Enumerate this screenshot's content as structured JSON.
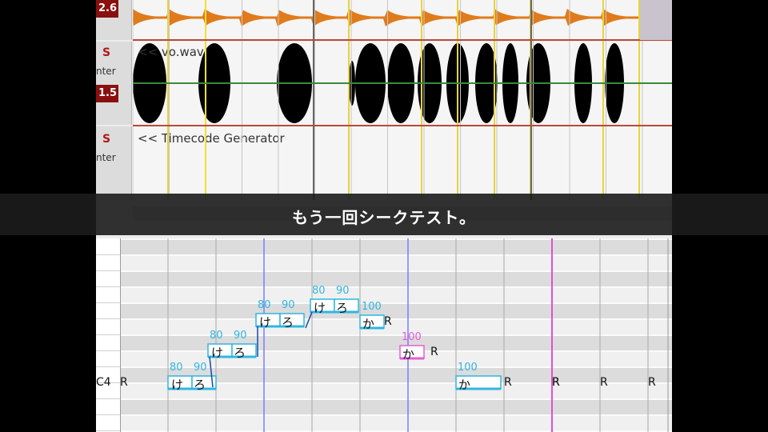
{
  "caption": "もう一回シークテスト。",
  "tracks": [
    {
      "solo_label": "S",
      "pan_label": "nter",
      "volume": "2.6",
      "lane_label": ""
    },
    {
      "solo_label": "S",
      "pan_label": "nter",
      "volume": "1.5",
      "lane_label": "<< vo.wav"
    },
    {
      "solo_label": "S",
      "pan_label": "nter",
      "volume": "",
      "lane_label": "<< Timecode Generator"
    }
  ],
  "colors": {
    "wave_orange": "#e07b1c",
    "wave_purple": "#7b3a9a",
    "note_blue": "#2fb6e0",
    "note_pink": "#e85ad9",
    "marker_pink": "#e34fd6"
  },
  "piano_roll": {
    "key_label": "C4",
    "notes": [
      {
        "group": 1,
        "lyrics": [
          "け",
          "ろ"
        ],
        "velocities": [
          "80",
          "90"
        ]
      },
      {
        "group": 2,
        "lyrics": [
          "け",
          "ろ"
        ],
        "velocities": [
          "80",
          "90"
        ]
      },
      {
        "group": 3,
        "lyrics": [
          "け",
          "ろ"
        ],
        "velocities": [
          "80",
          "90"
        ]
      },
      {
        "group": 4,
        "lyrics": [
          "け",
          "ろ"
        ],
        "velocities": [
          "80",
          "90"
        ]
      },
      {
        "group": 5,
        "lyrics": [
          "か"
        ],
        "velocities": [
          "100"
        ]
      },
      {
        "group": 6,
        "lyrics": [
          "か"
        ],
        "velocities": [
          "100"
        ]
      },
      {
        "group": 7,
        "lyrics": [
          "か"
        ],
        "velocities": [
          "100"
        ]
      }
    ],
    "rests": [
      "R",
      "R",
      "R",
      "R",
      "R",
      "R",
      "R",
      "R"
    ]
  }
}
